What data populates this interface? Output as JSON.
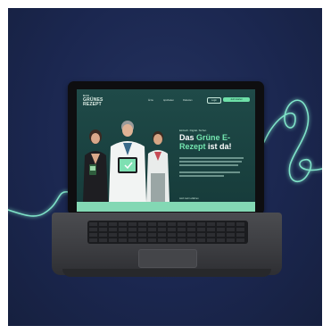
{
  "site": {
    "logo": {
      "line1": "DAS",
      "line2": "GRÜNES",
      "line3": "REZEPT"
    },
    "nav": {
      "links": [
        "Ärzte",
        "Apotheken",
        "Patienten"
      ],
      "login_label": "Login",
      "cta_label": "Jetzt starten"
    },
    "hero": {
      "eyebrow": "Einfach. Digital. Sicher.",
      "headline_pre": "Das ",
      "headline_accent": "Grüne E-Rezept",
      "headline_post": " ist da!",
      "cta_link": "Jetzt mehr erfahren"
    }
  },
  "colors": {
    "background": "#1b2750",
    "cable": "#7fe3c8",
    "accent": "#74e6b0",
    "screen": "#1f4a48"
  }
}
